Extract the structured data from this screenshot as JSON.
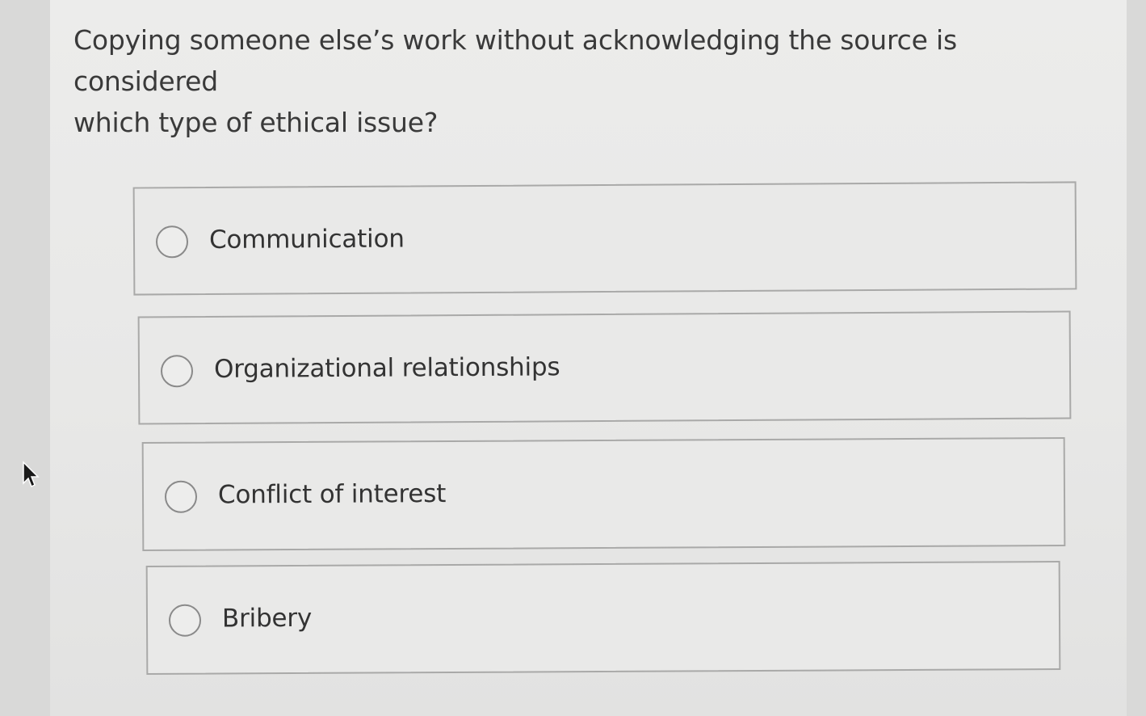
{
  "question": {
    "line1": "Copying someone else’s work without acknowledging the source is considered",
    "line2": "which type of ethical issue?"
  },
  "options": [
    {
      "label": "Communication",
      "selected": false
    },
    {
      "label": "Organizational relationships",
      "selected": false
    },
    {
      "label": "Conflict of interest",
      "selected": false
    },
    {
      "label": "Bribery",
      "selected": false
    }
  ],
  "icons": {
    "radio": "radio-unchecked-icon",
    "cursor": "mouse-pointer-icon"
  }
}
